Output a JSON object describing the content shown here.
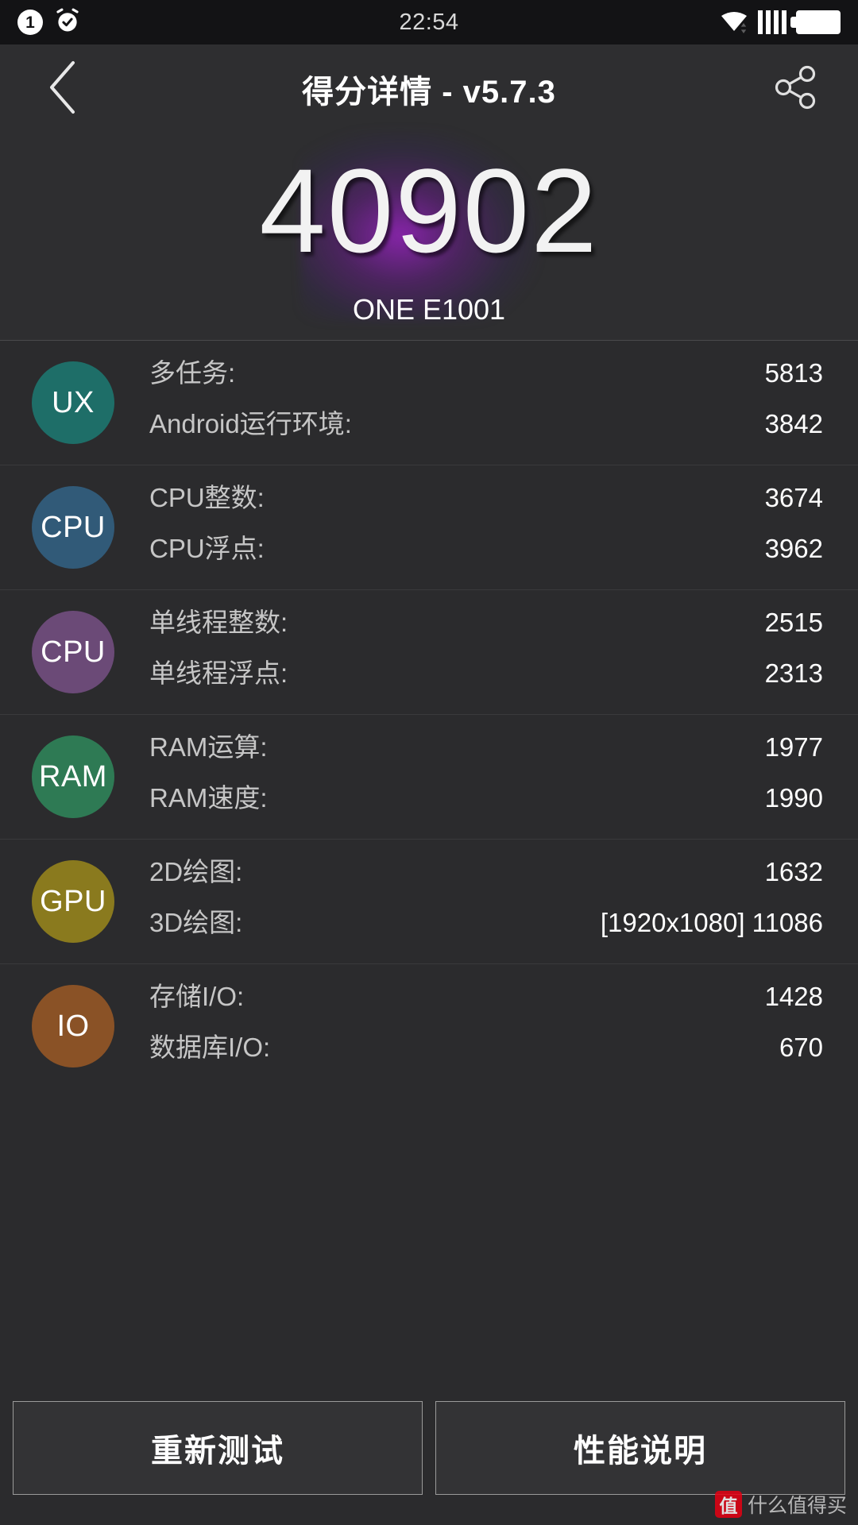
{
  "statusbar": {
    "time": "22:54",
    "notification_count": "1",
    "icons": [
      "notification-badge-icon",
      "alarm-clock-icon",
      "wifi-icon",
      "signal-bars-icon",
      "battery-icon"
    ]
  },
  "header": {
    "title": "得分详情 - v5.7.3",
    "back_icon": "chevron-left-icon",
    "share_icon": "share-icon"
  },
  "hero": {
    "score": "40902",
    "device": "ONE E1001",
    "glow_color": "#9623be"
  },
  "sections": [
    {
      "badge": "UX",
      "color": "#1e6e68",
      "rows": [
        {
          "label": "多任务:",
          "value": "5813"
        },
        {
          "label": "Android运行环境:",
          "value": "3842"
        }
      ]
    },
    {
      "badge": "CPU",
      "color": "#315a78",
      "rows": [
        {
          "label": "CPU整数:",
          "value": "3674"
        },
        {
          "label": "CPU浮点:",
          "value": "3962"
        }
      ]
    },
    {
      "badge": "CPU",
      "color": "#6b4a77",
      "rows": [
        {
          "label": "单线程整数:",
          "value": "2515"
        },
        {
          "label": "单线程浮点:",
          "value": "2313"
        }
      ]
    },
    {
      "badge": "RAM",
      "color": "#2e7a54",
      "rows": [
        {
          "label": "RAM运算:",
          "value": "1977"
        },
        {
          "label": "RAM速度:",
          "value": "1990"
        }
      ]
    },
    {
      "badge": "GPU",
      "color": "#8a7a1e",
      "rows": [
        {
          "label": "2D绘图:",
          "value": "1632"
        },
        {
          "label": "3D绘图:",
          "value": "[1920x1080] 11086"
        }
      ]
    },
    {
      "badge": "IO",
      "color": "#8a5226",
      "rows": [
        {
          "label": "存储I/O:",
          "value": "1428"
        },
        {
          "label": "数据库I/O:",
          "value": "670"
        }
      ]
    }
  ],
  "footer": {
    "retest_label": "重新测试",
    "perf_label": "性能说明"
  },
  "watermark": {
    "logo": "值",
    "text": "什么值得买"
  }
}
